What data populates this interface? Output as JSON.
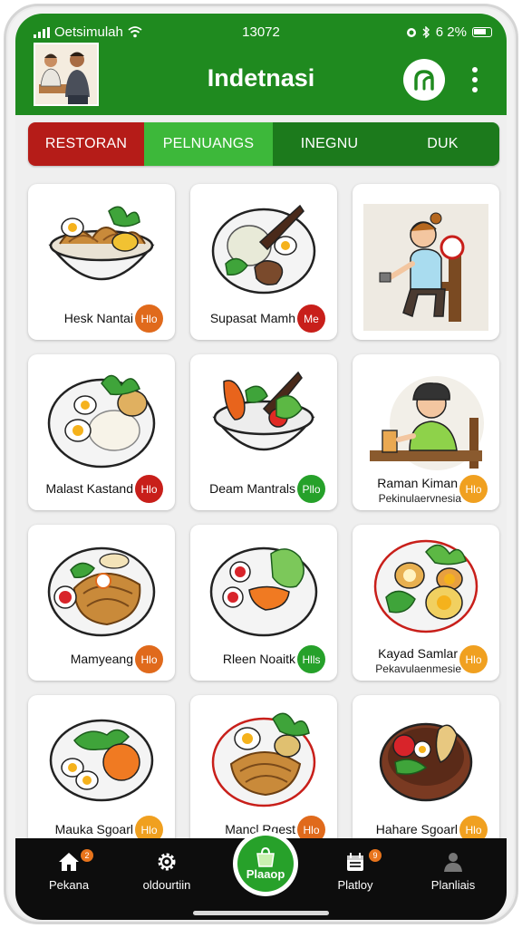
{
  "status_bar": {
    "carrier": "Oetsimulah",
    "time": "13072",
    "battery_text": "6 2%"
  },
  "header": {
    "title": "Indetnasi",
    "brand_color": "#1f8a1f"
  },
  "tabs": [
    {
      "label": "RESTORAN",
      "color": "#b51c18"
    },
    {
      "label": "PELNUANGS",
      "color": "#3db83a"
    },
    {
      "label": "INEGNU",
      "color": "#1c7a1c"
    },
    {
      "label": "DUK",
      "color": "#1c7a1c"
    }
  ],
  "cards": [
    {
      "name": "Hesk Nantai",
      "sub": "",
      "price": "Hlo",
      "badge_color": "#e06a1c",
      "icon": "noodle-bowl-icon"
    },
    {
      "name": "Supasat Mamh",
      "sub": "",
      "price": "Me",
      "badge_color": "#c81f1a",
      "icon": "satay-bowl-icon"
    },
    {
      "name": "",
      "sub": "",
      "price": "",
      "badge_color": "",
      "icon": "woman-chef-illustration"
    },
    {
      "name": "Malast Kastand",
      "sub": "",
      "price": "Hlo",
      "badge_color": "#c81f1a",
      "icon": "rice-plate-icon"
    },
    {
      "name": "Deam Mantrals",
      "sub": "",
      "price": "Pllo",
      "badge_color": "#26a12a",
      "icon": "vegetable-bowl-icon"
    },
    {
      "name": "Raman Kiman",
      "sub": "Pekinulaervnesia",
      "price": "Hlo",
      "badge_color": "#f0a020",
      "icon": "man-drinking-illustration"
    },
    {
      "name": "Mamyeang",
      "sub": "",
      "price": "Hlo",
      "badge_color": "#e06a1c",
      "icon": "fried-noodle-plate-icon"
    },
    {
      "name": "Rleen Noaitk",
      "sub": "",
      "price": "Hlls",
      "badge_color": "#26a12a",
      "icon": "salad-plate-icon"
    },
    {
      "name": "Kayad Samlar",
      "sub": "Pekavulaenmesie",
      "price": "Hlo",
      "badge_color": "#f0a020",
      "icon": "egg-plate-icon"
    },
    {
      "name": "Mauka Sgoarl",
      "sub": "",
      "price": "Hlo",
      "badge_color": "#f0a020",
      "icon": "tomato-plate-icon"
    },
    {
      "name": "Mancl Rgest",
      "sub": "",
      "price": "Hlo",
      "badge_color": "#e06a1c",
      "icon": "mixed-noodle-plate-icon"
    },
    {
      "name": "Hahare Sgoarl",
      "sub": "",
      "price": "Hlo",
      "badge_color": "#f0a020",
      "icon": "clay-pot-icon"
    }
  ],
  "bottom_nav": {
    "items": [
      {
        "label": "Pekana",
        "icon": "home-icon",
        "badge": "2"
      },
      {
        "label": "oldourtiin",
        "icon": "gear-icon",
        "badge": ""
      },
      {
        "label": "Plaaop",
        "icon": "shopping-bag-icon",
        "badge": ""
      },
      {
        "label": "Platloy",
        "icon": "calendar-icon",
        "badge": "9"
      },
      {
        "label": "Planliais",
        "icon": "person-icon",
        "badge": ""
      }
    ]
  }
}
